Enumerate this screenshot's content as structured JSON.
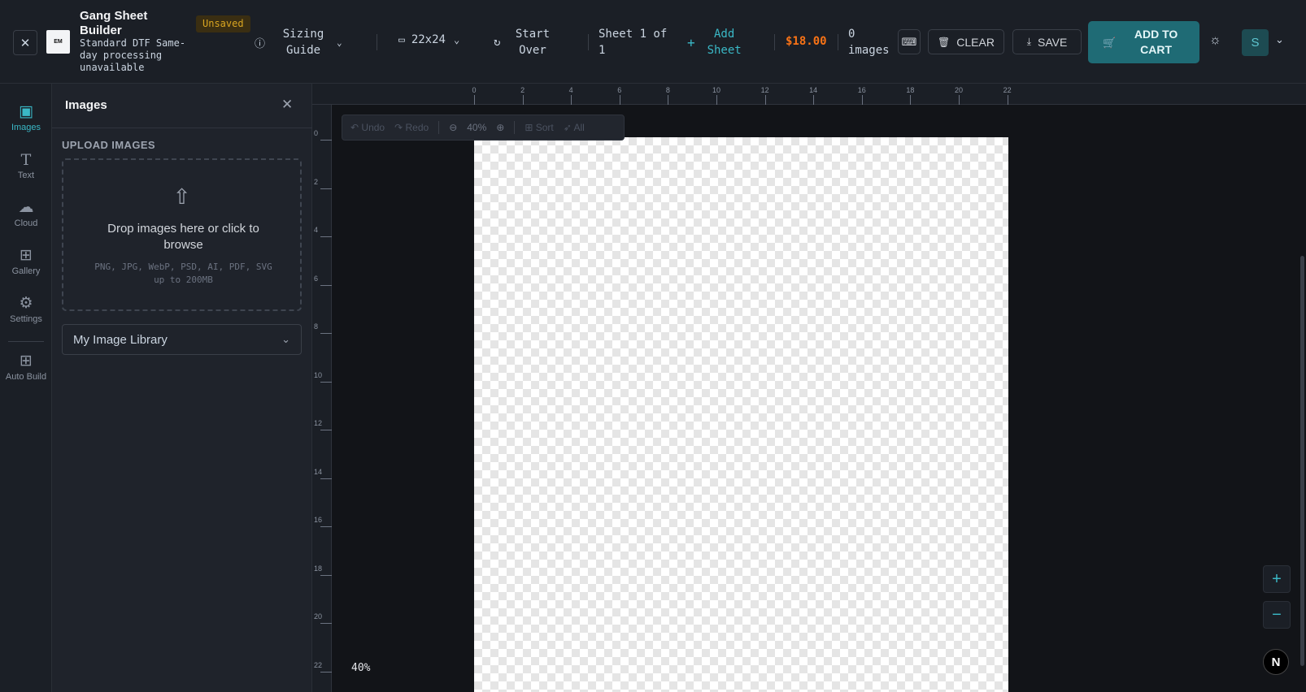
{
  "app": {
    "title": "Gang Sheet Builder",
    "subtitle": "Standard DTF Same-day processing unavailable",
    "status_badge": "Unsaved",
    "logo_text": "EM"
  },
  "toolbar": {
    "sizing_guide": "Sizing Guide",
    "sheet_size": "22x24",
    "start_over": "Start Over",
    "sheet_counter": "Sheet 1 of 1",
    "add_sheet": "Add Sheet",
    "price": "$18.00",
    "image_count": "0 images",
    "clear_label": "CLEAR",
    "save_label": "SAVE",
    "add_to_cart_label": "ADD TO CART",
    "user_initial": "S",
    "accent_color": "#3ab8c6",
    "price_color": "#f97316"
  },
  "rail": {
    "items": [
      {
        "label": "Images",
        "icon": "image-icon",
        "active": true
      },
      {
        "label": "Text",
        "icon": "text-icon",
        "active": false
      },
      {
        "label": "Cloud",
        "icon": "cloud-icon",
        "active": false
      },
      {
        "label": "Gallery",
        "icon": "grid-icon",
        "active": false
      },
      {
        "label": "Settings",
        "icon": "gear-icon",
        "active": false
      },
      {
        "label": "Auto Build",
        "icon": "grid-icon",
        "active": false
      }
    ]
  },
  "panel": {
    "title": "Images",
    "upload_label": "UPLOAD IMAGES",
    "drop_text": "Drop images here or click to browse",
    "formats_text": "PNG, JPG, WebP, PSD, AI, PDF, SVG up to 200MB",
    "library_select": "My Image Library"
  },
  "canvas": {
    "undo": "Undo",
    "redo": "Redo",
    "zoom": "40%",
    "sort": "Sort",
    "all": "All",
    "zoom_label": "40%",
    "ruler_top": [
      "0",
      "2",
      "4",
      "6",
      "8",
      "10",
      "12",
      "14",
      "16",
      "18",
      "20",
      "22"
    ],
    "ruler_left": [
      "0",
      "2",
      "4",
      "6",
      "8",
      "10",
      "12",
      "14",
      "16",
      "18",
      "20",
      "22"
    ],
    "n_badge": "N"
  }
}
